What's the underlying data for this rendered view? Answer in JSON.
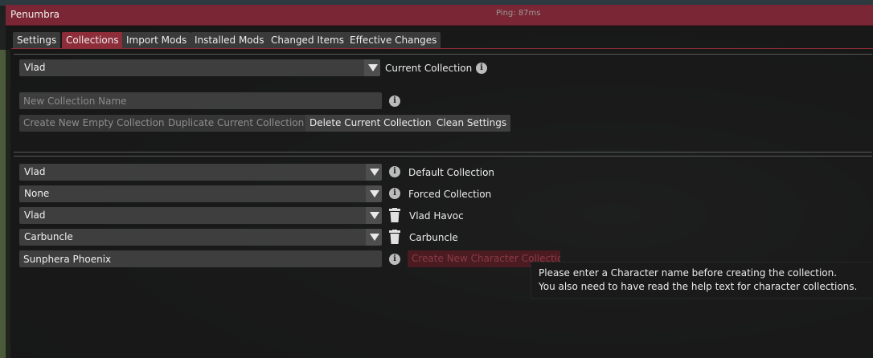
{
  "window": {
    "title": "Penumbra",
    "ping": "Ping: 87ms"
  },
  "tabs": [
    {
      "label": "Settings",
      "active": false
    },
    {
      "label": "Collections",
      "active": true
    },
    {
      "label": "Import Mods",
      "active": false
    },
    {
      "label": "Installed Mods",
      "active": false
    },
    {
      "label": "Changed Items",
      "active": false
    },
    {
      "label": "Effective Changes",
      "active": false
    }
  ],
  "current_collection": {
    "value": "Vlad",
    "label": "Current Collection"
  },
  "new_collection": {
    "placeholder": "New Collection Name",
    "value": ""
  },
  "actions": {
    "create_empty": "Create New Empty Collection",
    "duplicate": "Duplicate Current Collection",
    "delete": "Delete Current Collection",
    "clean": "Clean Settings"
  },
  "assignments": [
    {
      "value": "Vlad",
      "label": "Default Collection",
      "icon": "info-icon"
    },
    {
      "value": "None",
      "label": "Forced Collection",
      "icon": "info-icon"
    },
    {
      "value": "Vlad",
      "label": "Vlad Havoc",
      "icon": "trash-icon"
    },
    {
      "value": "Carbuncle",
      "label": "Carbuncle",
      "icon": "trash-icon"
    }
  ],
  "character": {
    "value": "Sunphera Phoenix",
    "create_button": "Create New Character Collection"
  },
  "tooltip": {
    "line1": "Please enter a Character name before creating the collection.",
    "line2": "You also need to have read the help text for character collections."
  },
  "colors": {
    "title_bar": "#7a2634",
    "active_tab": "#8e2d3a",
    "window_bg": "#141414"
  }
}
